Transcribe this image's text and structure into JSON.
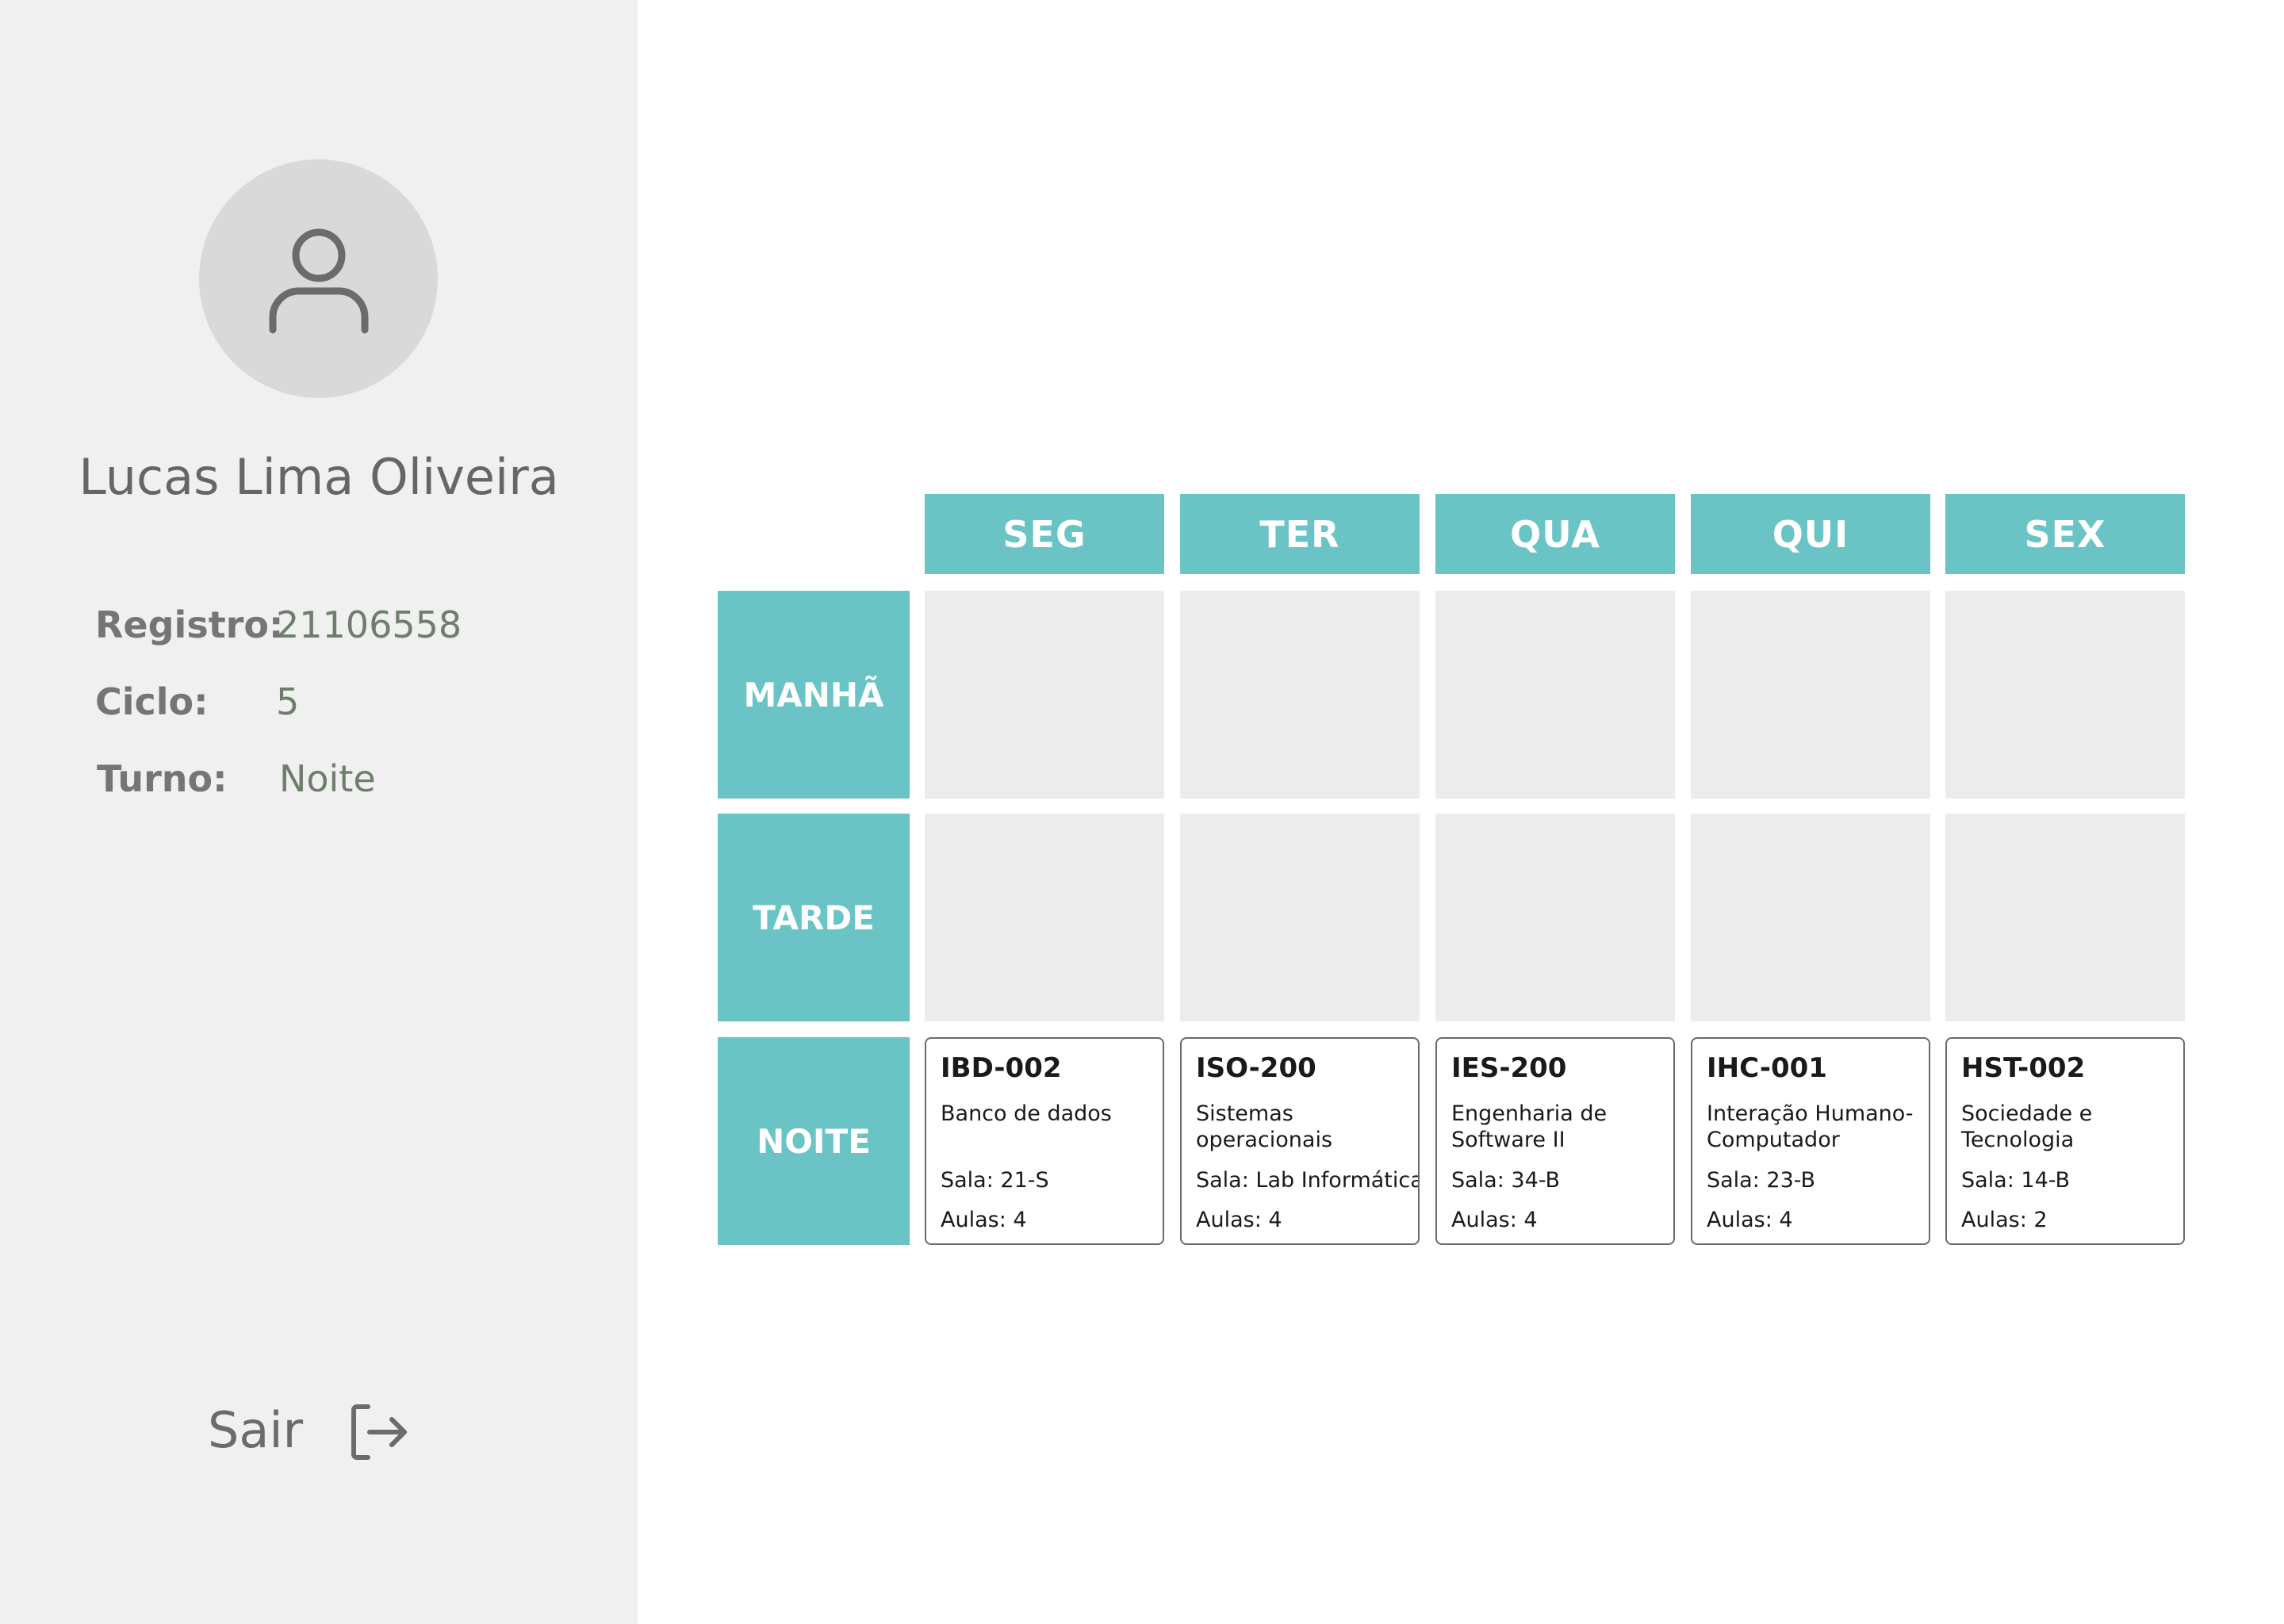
{
  "user": {
    "name": "Lucas Lima Oliveira",
    "avatar_icon": "user-icon",
    "fields": [
      {
        "label": "Registro:",
        "value": "21106558"
      },
      {
        "label": "Ciclo:",
        "value": "5"
      },
      {
        "label": "Turno:",
        "value": "Noite"
      }
    ]
  },
  "logout": {
    "label": "Sair",
    "icon": "logout-icon"
  },
  "schedule": {
    "days": [
      "SEG",
      "TER",
      "QUA",
      "QUI",
      "SEX"
    ],
    "periods": [
      "MANHÃ",
      "TARDE",
      "NOITE"
    ],
    "night_classes": [
      {
        "code": "IBD-002",
        "name": "Banco de dados",
        "room": "Sala: 21-S",
        "lessons": "Aulas: 4"
      },
      {
        "code": "ISO-200",
        "name": "Sistemas operacionais",
        "room": "Sala: Lab Informática",
        "lessons": "Aulas: 4"
      },
      {
        "code": "IES-200",
        "name": "Engenharia de Software II",
        "room": "Sala: 34-B",
        "lessons": "Aulas: 4"
      },
      {
        "code": "IHC-001",
        "name": "Interação Humano-Computador",
        "room": "Sala: 23-B",
        "lessons": "Aulas: 4"
      },
      {
        "code": "HST-002",
        "name": "Sociedade e Tecnologia",
        "room": "Sala: 14-B",
        "lessons": "Aulas: 2"
      }
    ]
  },
  "colors": {
    "accent": "#6ac4c5",
    "sidebar_bg": "#f0f0f0",
    "empty_cell": "#ececec"
  }
}
